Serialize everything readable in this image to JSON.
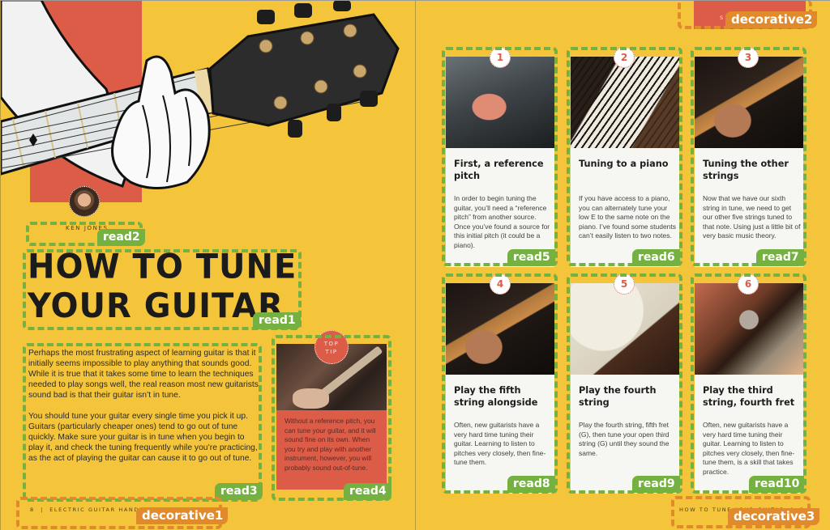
{
  "left_page": {
    "author": "KEN JONES",
    "title_line1": "HOW TO TUNE",
    "title_line2": "YOUR GUITAR",
    "body": [
      "Perhaps the most frustrating aspect of learning guitar is that it initially seems impossible to play anything that sounds good. While it is true that it takes some time to learn the techniques needed to play songs well, the real reason most new guitarists sound bad is that their guitar isn’t in tune.",
      "You should tune your guitar every single time you pick it up. Guitars (particularly cheaper ones) tend to go out of tune quickly. Make sure your guitar is in tune when you begin to play it, and check the tuning frequently while you’re practicing, as the act of playing the guitar can cause it to go out of tune."
    ],
    "tip_badge_line1": "TOP",
    "tip_badge_line2": "TIP",
    "tip_text": "Without a reference pitch, you can tune your guitar, and it will sound fine on its own. When you try and play with another instrument, however, you will probably sound out-of-tune.",
    "footer": "8  |  ELECTRIC GUITAR HANDBOOK"
  },
  "right_page": {
    "header_fragment": "S",
    "footer": "HOW TO TUNE YOUR GUITAR  |  9",
    "steps": [
      {
        "num": "1",
        "title": "First, a reference pitch",
        "text": "In order to begin tuning the guitar, you’ll need a “reference pitch” from another source. Once you’ve found a source for this initial pitch (it could be a piano)."
      },
      {
        "num": "2",
        "title": "Tuning to a piano",
        "text": "If you have access to a piano, you can alternately tune your low E to the same note on the piano. I’ve found some students can’t easily listen to two notes."
      },
      {
        "num": "3",
        "title": "Tuning the other strings",
        "text": "Now that we have our sixth string in tune, we need to get our other five strings tuned to that note. Using just a little bit of very basic music theory."
      },
      {
        "num": "4",
        "title": "Play the fifth string alongside",
        "text": "Often, new guitarists have a very hard time tuning their guitar. Learning to listen to pitches very closely, then fine-tune them."
      },
      {
        "num": "5",
        "title": "Play the fourth string",
        "text": "Play the fourth string, fifth fret (G), then tune your open third string (G) until they sound the same."
      },
      {
        "num": "6",
        "title": "Play the third string, fourth fret",
        "text": "Often, new guitarists have a very hard time tuning their guitar. Learning to listen to pitches very closely, then fine-tune them, is a skill that takes practice."
      }
    ]
  },
  "annotations": {
    "read1": "read1",
    "read2": "read2",
    "read3": "read3",
    "read4": "read4",
    "read5": "read5",
    "read6": "read6",
    "read7": "read7",
    "read8": "read8",
    "read9": "read9",
    "read10": "read10",
    "decorative1": "decorative1",
    "decorative2": "decorative2",
    "decorative3": "decorative3"
  },
  "colors": {
    "page_bg": "#f4c53a",
    "accent_red": "#dd5c48",
    "read_green": "#74b140",
    "decorative_orange": "#e08a2c"
  }
}
